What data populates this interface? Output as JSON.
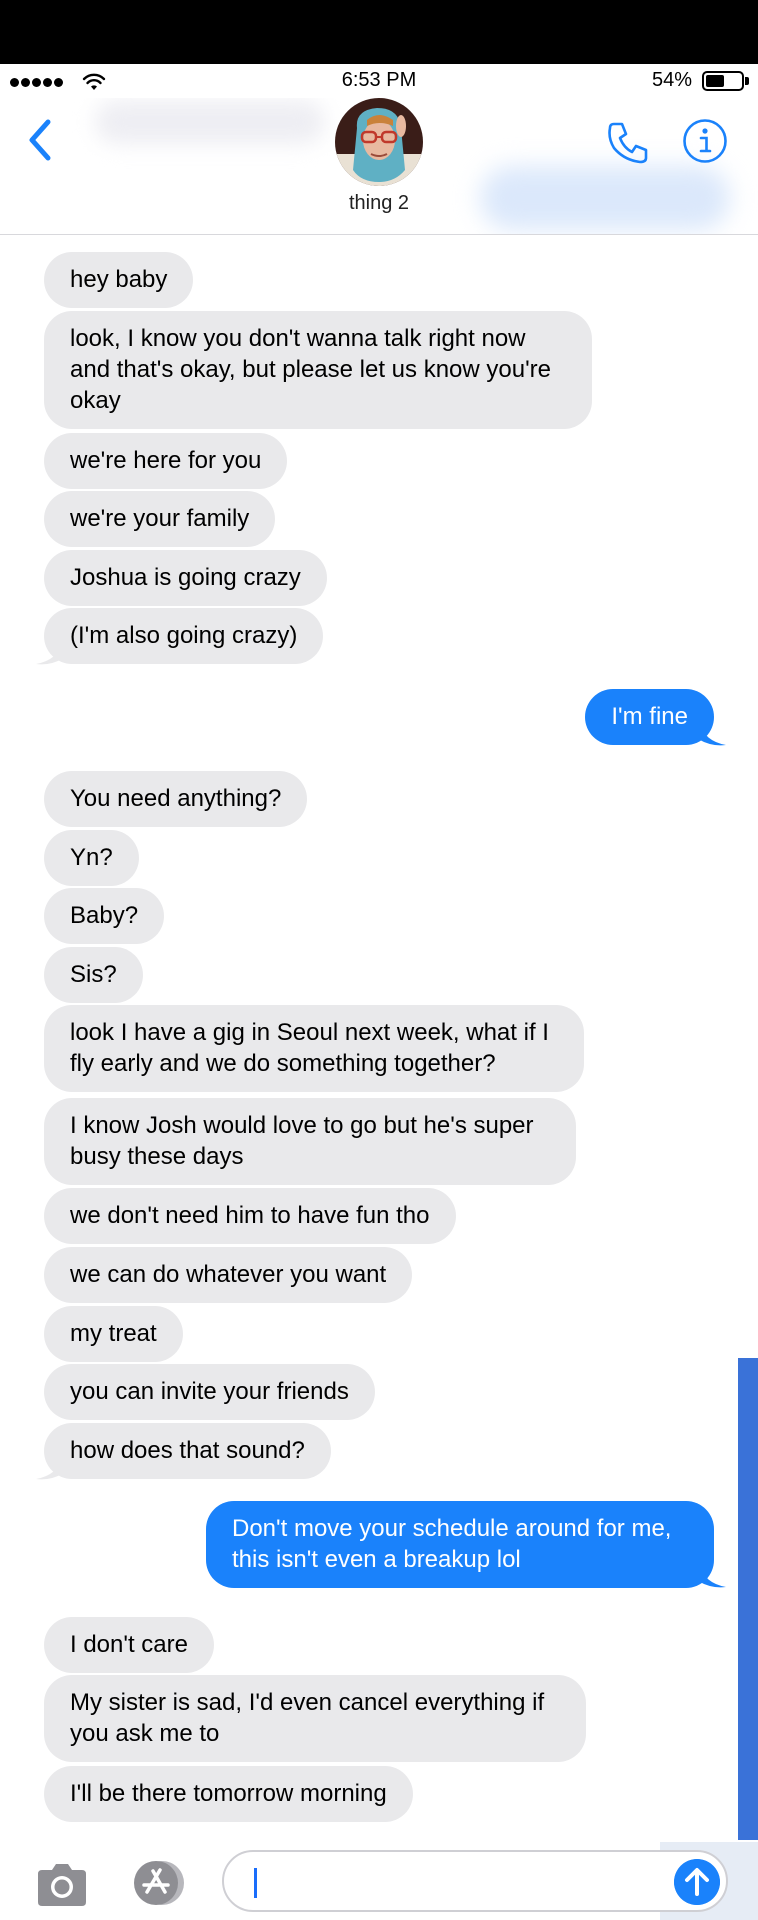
{
  "status_bar": {
    "time": "6:53 PM",
    "battery": "54%",
    "battery_level": 0.54
  },
  "header": {
    "contact_name": "thing 2"
  },
  "messages": [
    {
      "side": "in",
      "text": "hey baby"
    },
    {
      "side": "in",
      "text": "look, I know you don't wanna talk right now and that's okay, but please let us know you're okay"
    },
    {
      "side": "in",
      "text": "we're here for you"
    },
    {
      "side": "in",
      "text": "we're your family"
    },
    {
      "side": "in",
      "text": "Joshua is going crazy"
    },
    {
      "side": "in",
      "text": "(I'm also going crazy)"
    },
    {
      "side": "out",
      "text": "I'm fine"
    },
    {
      "side": "in",
      "text": "You need anything?"
    },
    {
      "side": "in",
      "text": "Yn?"
    },
    {
      "side": "in",
      "text": "Baby?"
    },
    {
      "side": "in",
      "text": "Sis?"
    },
    {
      "side": "in",
      "text": "look I have a gig in Seoul next week, what if I fly early and we do something together?"
    },
    {
      "side": "in",
      "text": "I know Josh would love to go but he's super busy these days"
    },
    {
      "side": "in",
      "text": "we don't need him to have fun tho"
    },
    {
      "side": "in",
      "text": "we can do whatever you want"
    },
    {
      "side": "in",
      "text": "my treat"
    },
    {
      "side": "in",
      "text": "you can invite your friends"
    },
    {
      "side": "in",
      "text": "how does that sound?"
    },
    {
      "side": "out",
      "text": "Don't move your schedule around for me, this isn't even a breakup lol"
    },
    {
      "side": "in",
      "text": "I don't care"
    },
    {
      "side": "in",
      "text": "My sister is sad, I'd even cancel everything if you ask me to"
    },
    {
      "side": "in",
      "text": "I'll be there tomorrow morning"
    }
  ],
  "colors": {
    "incoming_bubble": "#e9e9eb",
    "outgoing_bubble": "#1a82fb",
    "accent": "#1a82fb"
  },
  "icons": {
    "back": "chevron-left-icon",
    "phone": "phone-icon",
    "info": "info-icon",
    "camera": "camera-icon",
    "apps": "app-store-icon",
    "send": "send-arrow-icon"
  }
}
